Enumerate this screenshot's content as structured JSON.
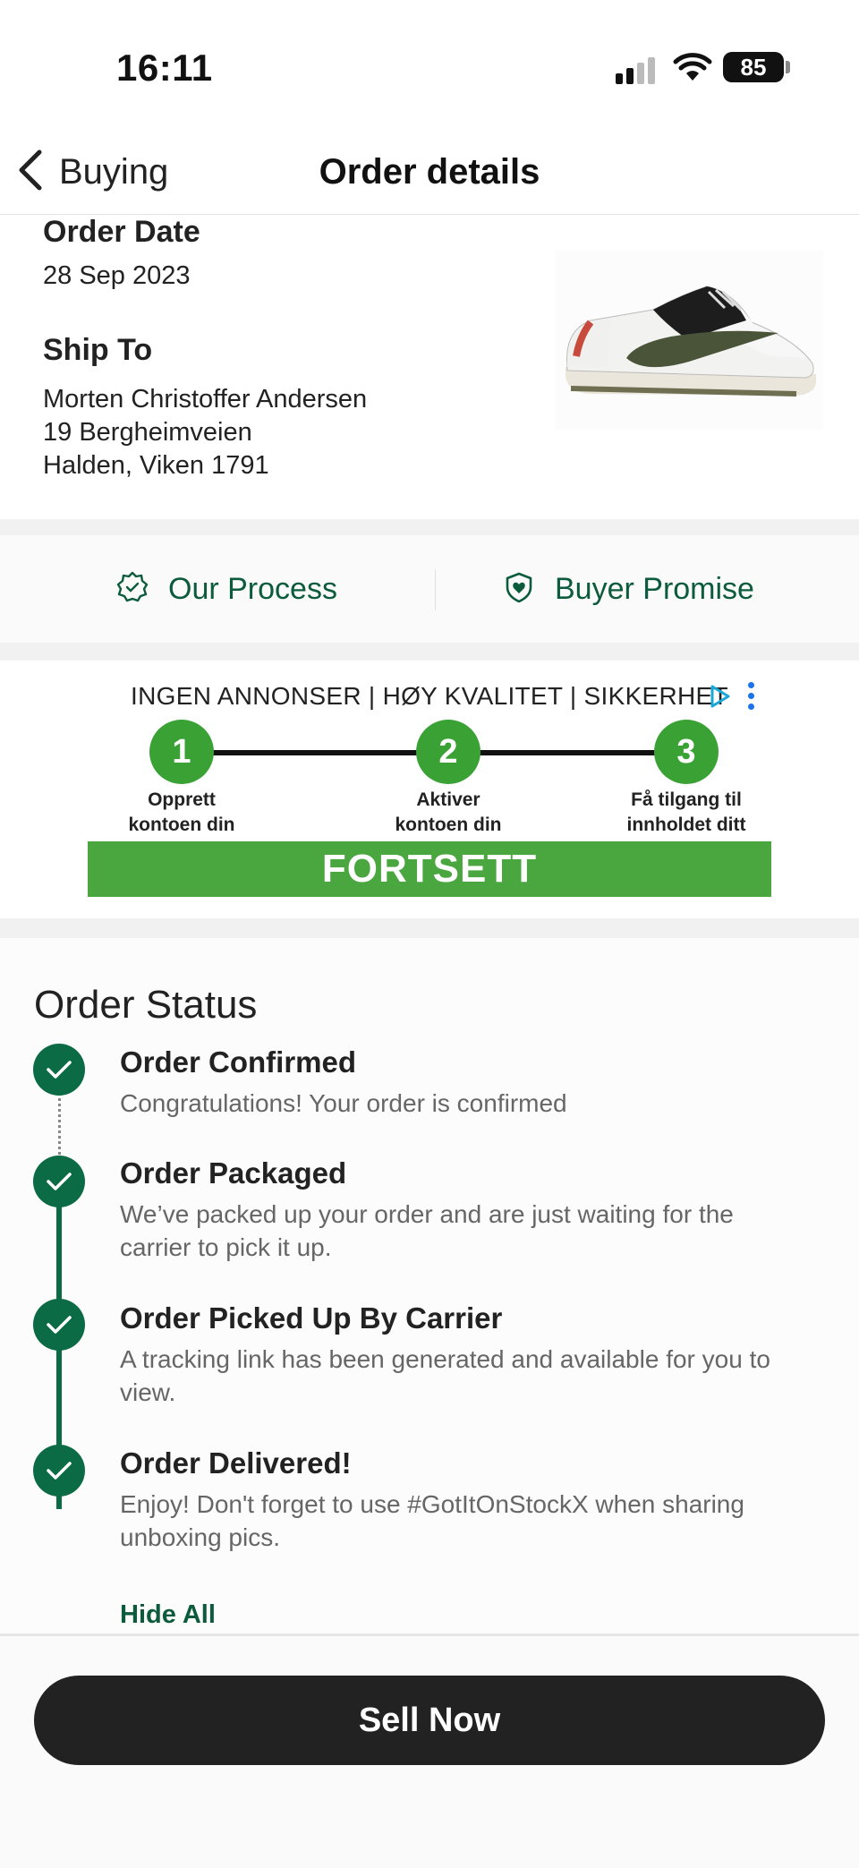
{
  "status_bar": {
    "time": "16:11",
    "battery": "85",
    "icons": [
      "signal-icon",
      "wifi-icon",
      "battery-icon"
    ]
  },
  "nav": {
    "back_label": "Buying",
    "title": "Order details"
  },
  "order": {
    "date_heading": "Order Date",
    "date": "28 Sep 2023",
    "ship_heading": "Ship To",
    "ship_name": "Morten Christoffer Andersen",
    "ship_street": "19 Bergheimveien",
    "ship_city": "Halden, Viken 1791",
    "product_image": "sneaker-image"
  },
  "links": {
    "process": "Our Process",
    "promise": "Buyer Promise"
  },
  "ad": {
    "headline": "INGEN ANNONSER | HØY KVALITET | SIKKERHET",
    "steps": [
      {
        "number": "1",
        "line1": "Opprett",
        "line2": "kontoen din"
      },
      {
        "number": "2",
        "line1": "Aktiver",
        "line2": "kontoen din"
      },
      {
        "number": "3",
        "line1": "Få tilgang til",
        "line2": "innholdet ditt"
      }
    ],
    "cta": "FORTSETT"
  },
  "order_status": {
    "heading": "Order Status",
    "steps": [
      {
        "title": "Order Confirmed",
        "desc": "Congratulations! Your order is confirmed"
      },
      {
        "title": "Order Packaged",
        "desc": "We’ve packed up your order and are just waiting for the carrier to pick it up."
      },
      {
        "title": "Order Picked Up By Carrier",
        "desc": "A tracking link has been generated and available for you to view."
      },
      {
        "title": "Order Delivered!",
        "desc": "Enjoy! Don't forget to use #GotItOnStockX when sharing unboxing pics."
      }
    ],
    "hide_all": "Hide All"
  },
  "actions": {
    "sell_now": "Sell Now"
  },
  "colors": {
    "brand_green": "#0b6b45",
    "ad_green": "#4aa740",
    "button_dark": "#222222"
  }
}
